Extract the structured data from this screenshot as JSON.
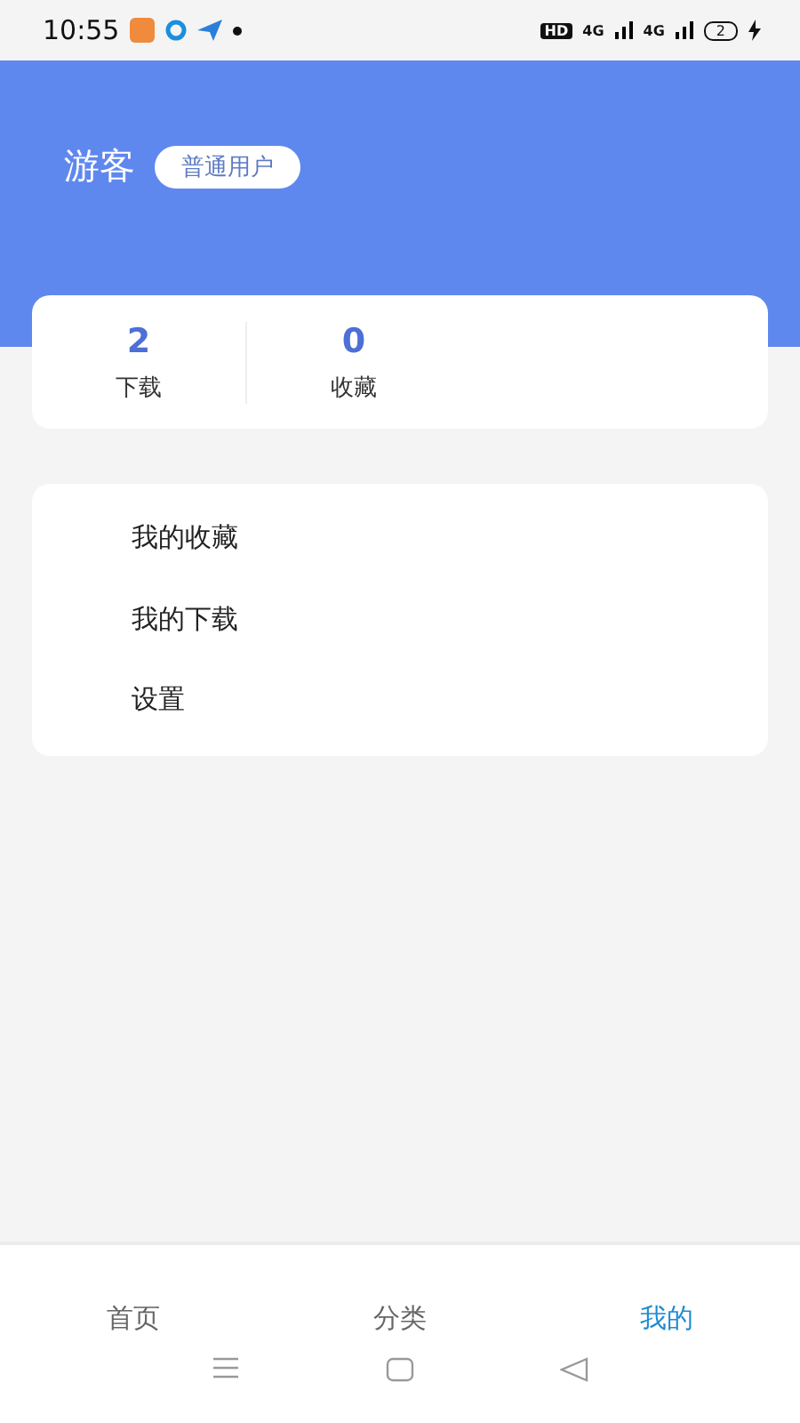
{
  "status_bar": {
    "time": "10:55",
    "hd": "HD",
    "signals": [
      "4G",
      "4G"
    ],
    "battery": "2"
  },
  "profile": {
    "name": "游客",
    "badge": "普通用户"
  },
  "stats": [
    {
      "value": "2",
      "label": "下载"
    },
    {
      "value": "0",
      "label": "收藏"
    }
  ],
  "menu": [
    "我的收藏",
    "我的下载",
    "设置"
  ],
  "tabs": [
    {
      "label": "首页",
      "selected": false
    },
    {
      "label": "分类",
      "selected": false
    },
    {
      "label": "我的",
      "selected": true
    }
  ]
}
